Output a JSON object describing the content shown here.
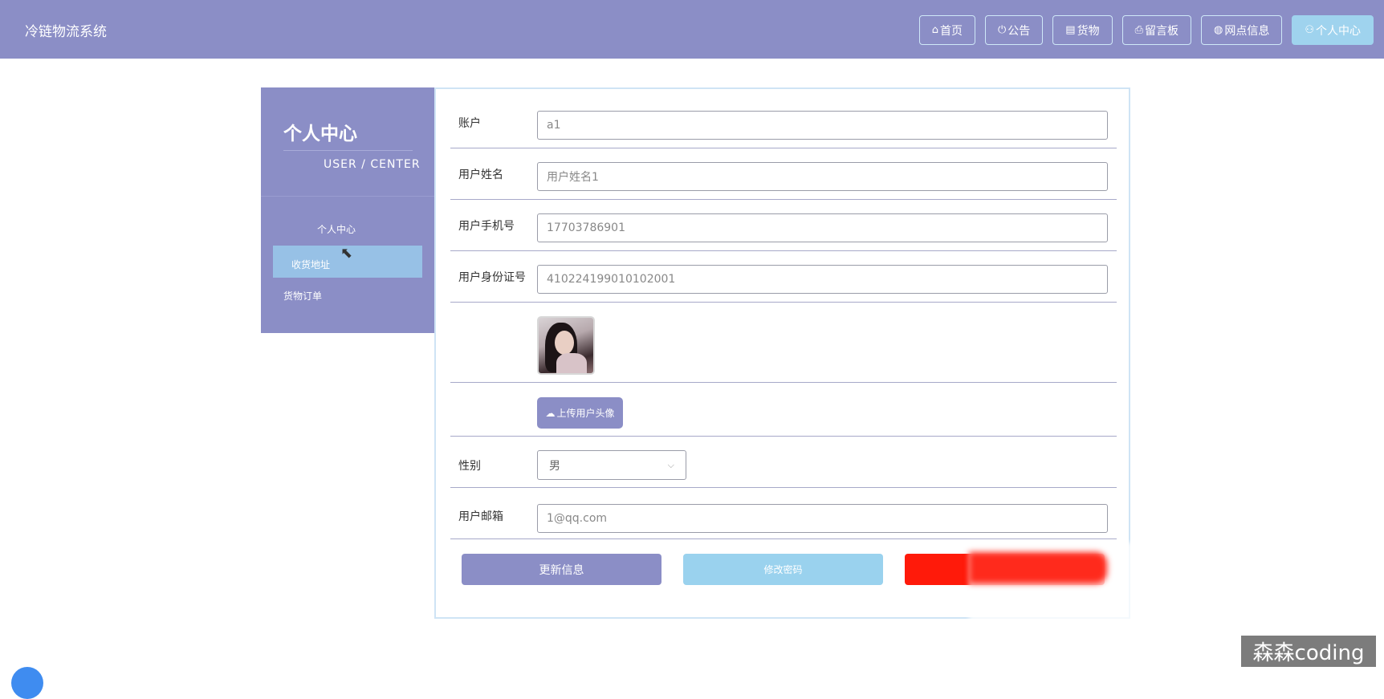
{
  "app": {
    "title": "冷链物流系统"
  },
  "nav": [
    {
      "icon": "home-icon",
      "glyph": "⌂",
      "label": "首页",
      "active": false
    },
    {
      "icon": "power-icon",
      "glyph": "⏻",
      "label": "公告",
      "active": false
    },
    {
      "icon": "calendar-icon",
      "glyph": "▤",
      "label": "货物",
      "active": false
    },
    {
      "icon": "printer-icon",
      "glyph": "⎙",
      "label": "留言板",
      "active": false
    },
    {
      "icon": "globe-icon",
      "glyph": "◍",
      "label": "网点信息",
      "active": false
    },
    {
      "icon": "user-icon",
      "glyph": "⚇",
      "label": "个人中心",
      "active": true
    }
  ],
  "sidebar": {
    "title": "个人中心",
    "subtitle": "USER / CENTER",
    "items": [
      {
        "label": "个人中心"
      },
      {
        "label": "收货地址"
      },
      {
        "label": "货物订单"
      }
    ]
  },
  "form": {
    "account": {
      "label": "账户",
      "value": "a1"
    },
    "name": {
      "label": "用户姓名",
      "value": "用户姓名1"
    },
    "phone": {
      "label": "用户手机号",
      "value": "17703786901"
    },
    "id_number": {
      "label": "用户身份证号",
      "value": "410224199010102001"
    },
    "upload_label": "上传用户头像",
    "gender": {
      "label": "性别",
      "value": "男"
    },
    "email": {
      "label": "用户邮箱",
      "value": "1@qq.com"
    }
  },
  "actions": {
    "update": "更新信息",
    "change_password": "修改密码"
  },
  "watermark": "森森coding",
  "colors": {
    "primary": "#8b8ec6",
    "accent": "#9ad2ee",
    "danger": "#ff1a0a"
  }
}
